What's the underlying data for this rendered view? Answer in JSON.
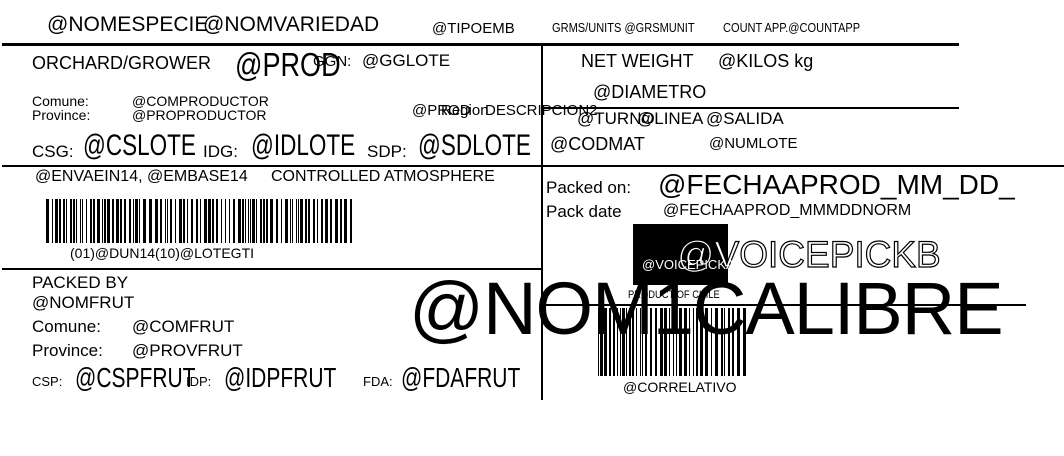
{
  "header": {
    "nomespecie": "@NOMESPECIE",
    "nomvariedad": "@NOMVARIEDAD",
    "tipoemb": "@TIPOEMB",
    "grms": "GRMS/UNITS @GRSMUNIT",
    "countapp": "COUNT APP.@COUNTAPP"
  },
  "orchard": {
    "label": "ORCHARD/GROWER",
    "prod": "@PROD",
    "ggn": "GGN:",
    "gglote": "@GGLOTE",
    "comune_label": "Comune:",
    "comune_value": "@COMPRODUCTOR",
    "province_label": "Province:",
    "province_value": "@PROPRODUCTOR",
    "csg_label": "CSG:",
    "csg_value": "@CSLOTE",
    "idg_label": "IDG:",
    "idg_value": "@IDLOTE",
    "sdp_label": "SDP:",
    "sdp_value": "@SDLOTE",
    "overlap_a": "@PROD",
    "overlap_b": "Region",
    "overlap_c": "DESCRIPCION2"
  },
  "weight": {
    "net_label": "NET WEIGHT",
    "kilos": "@KILOS kg",
    "diametro": "@DIAMETRO",
    "overlap_a": "@TURNO",
    "overlap_b": "@LINEA",
    "overlap_c": "@SALIDA",
    "codmat": "@CODMAT",
    "numlote": "@NUMLOTE"
  },
  "envase": {
    "text": "@ENVAEIN14, @EMBASE14",
    "atmosphere": "CONTROLLED ATMOSPHERE",
    "barcode_text": "(01)@DUN14(10)@LOTEGTI"
  },
  "packed": {
    "on_label": "Packed on:",
    "on_value": "@FECHAAPROD_MM_DD_",
    "date_label": "Pack date",
    "date_value": "@FECHAAPROD_MMMDDNORM",
    "voice_big": "@VOICEPICKB",
    "voice_small": "@VOICEPICKA",
    "product_of": "PRODUCT OF CHILE",
    "correlativo": "@CORRELATIVO"
  },
  "packer": {
    "packed_by": "PACKED BY",
    "nomfrut": "@NOMFRUT",
    "comune_label": "Comune:",
    "comune_value": "@COMFRUT",
    "province_label": "Province:",
    "province_value": "@PROVFRUT",
    "csp_label": "CSP:",
    "csp_value": "@CSPFRUT",
    "idp_label": "IDP:",
    "idp_value": "@IDPFRUT",
    "fda_label": "FDA:",
    "fda_value": "@FDAFRUT"
  },
  "calibre": "@NOM1CALIBRE"
}
